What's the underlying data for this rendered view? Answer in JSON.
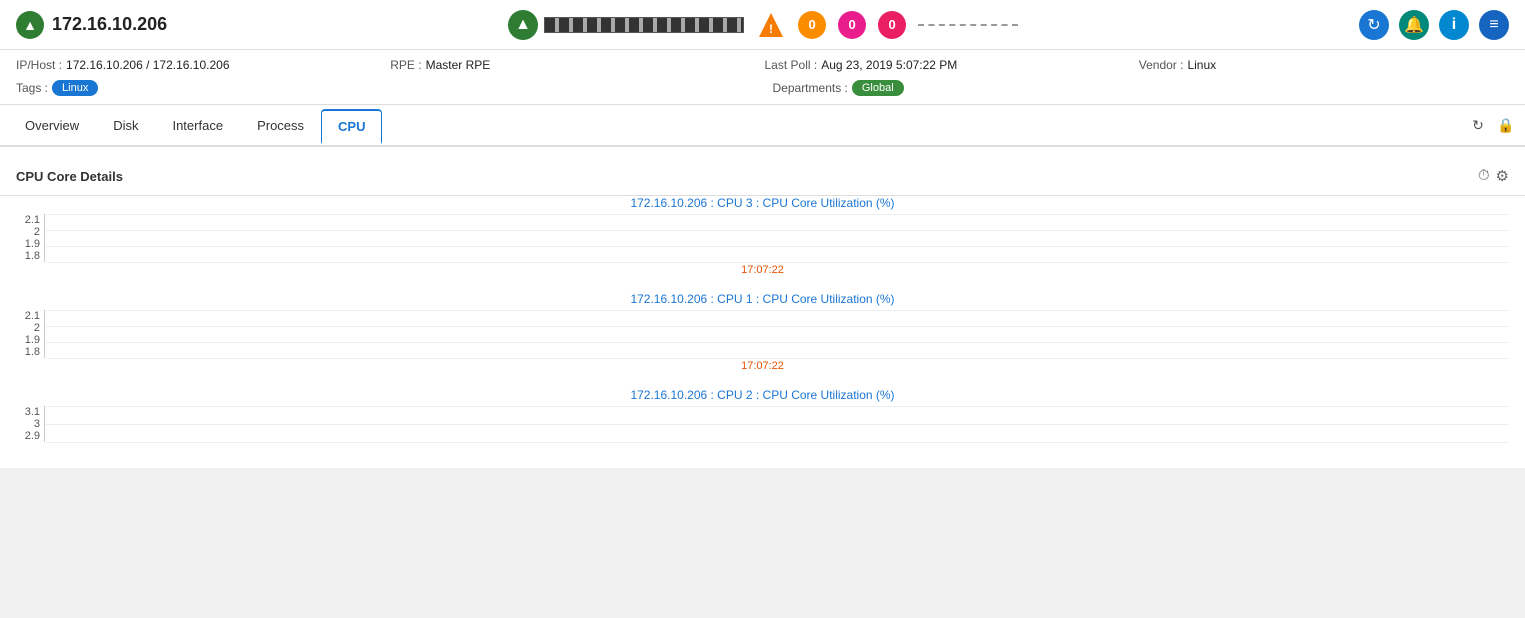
{
  "header": {
    "host": "172.16.10.206",
    "host_icon": "▲",
    "up_icon": "▲",
    "alert_icon": "!",
    "badge1": "0",
    "badge2": "0",
    "badge3": "0",
    "dashed_line": "- - - - - - - -",
    "refresh_icon": "↻",
    "bell_icon": "🔔",
    "info_icon": "i",
    "menu_icon": "≡"
  },
  "info_bar": {
    "ip_label": "IP/Host :",
    "ip_value": "172.16.10.206 / 172.16.10.206",
    "rpe_label": "RPE :",
    "rpe_value": "Master RPE",
    "last_poll_label": "Last Poll :",
    "last_poll_value": "Aug 23, 2019 5:07:22 PM",
    "vendor_label": "Vendor :",
    "vendor_value": "Linux",
    "tags_label": "Tags :",
    "tags_value": "Linux",
    "departments_label": "Departments :",
    "departments_value": "Global"
  },
  "tabs": [
    {
      "id": "overview",
      "label": "Overview",
      "active": false
    },
    {
      "id": "disk",
      "label": "Disk",
      "active": false
    },
    {
      "id": "interface",
      "label": "Interface",
      "active": false
    },
    {
      "id": "process",
      "label": "Process",
      "active": false
    },
    {
      "id": "cpu",
      "label": "CPU",
      "active": true
    }
  ],
  "tab_icons": {
    "refresh": "↻",
    "lock": "🔒"
  },
  "section": {
    "title": "CPU Core Details",
    "icon_clock": "⏱",
    "icon_gear": "⚙"
  },
  "charts": [
    {
      "id": "cpu3",
      "title": "172.16.10.206 : CPU 3 : CPU Core Utilization (%)",
      "y_labels": [
        "2.1",
        "2",
        "1.9",
        "1.8"
      ],
      "time_label": "17:07:22"
    },
    {
      "id": "cpu1",
      "title": "172.16.10.206 : CPU 1 : CPU Core Utilization (%)",
      "y_labels": [
        "2.1",
        "2",
        "1.9",
        "1.8"
      ],
      "time_label": "17:07:22"
    },
    {
      "id": "cpu2",
      "title": "172.16.10.206 : CPU 2 : CPU Core Utilization (%)",
      "y_labels": [
        "3.1",
        "3",
        "2.9"
      ],
      "time_label": ""
    }
  ]
}
